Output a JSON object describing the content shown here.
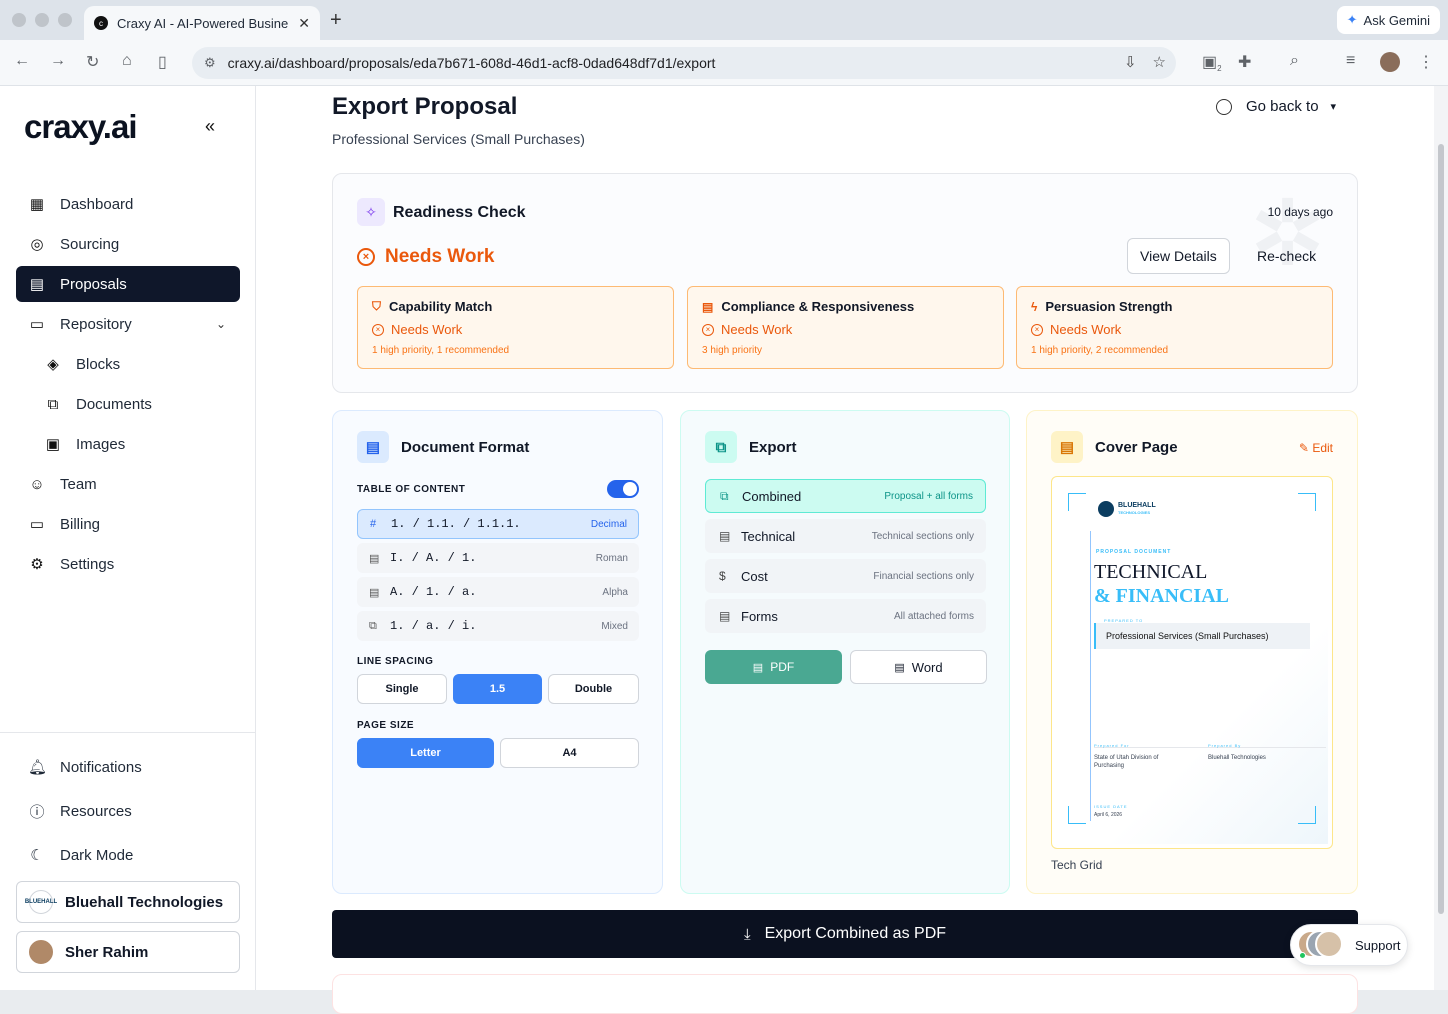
{
  "browser": {
    "tab_title": "Craxy AI - AI-Powered Busine",
    "url": "craxy.ai/dashboard/proposals/eda7b671-608d-46d1-acf8-0dad648df7d1/export",
    "ask_gemini": "Ask Gemini",
    "ext_badge": "2"
  },
  "sidebar": {
    "logo": "craxy.ai",
    "items": [
      {
        "label": "Dashboard",
        "icon": "dashboard-icon"
      },
      {
        "label": "Sourcing",
        "icon": "target-icon"
      },
      {
        "label": "Proposals",
        "icon": "proposal-icon"
      },
      {
        "label": "Repository",
        "icon": "book-icon"
      },
      {
        "label": "Blocks",
        "icon": "layers-icon"
      },
      {
        "label": "Documents",
        "icon": "documents-icon"
      },
      {
        "label": "Images",
        "icon": "image-icon"
      },
      {
        "label": "Team",
        "icon": "team-icon"
      },
      {
        "label": "Billing",
        "icon": "card-icon"
      },
      {
        "label": "Settings",
        "icon": "gear-icon"
      }
    ],
    "bottom": {
      "notifications": "Notifications",
      "resources": "Resources",
      "dark_mode": "Dark Mode",
      "org": "Bluehall Technologies",
      "org_logo_text": "BLUEHALL",
      "user": "Sher Rahim"
    }
  },
  "header": {
    "title": "Export Proposal",
    "subtitle": "Professional Services (Small Purchases)",
    "go_back": "Go back to"
  },
  "readiness": {
    "title": "Readiness Check",
    "time": "10 days ago",
    "status": "Needs Work",
    "view_details": "View Details",
    "recheck": "Re-check",
    "cards": [
      {
        "title": "Capability Match",
        "status": "Needs Work",
        "note": "1 high priority, 1 recommended"
      },
      {
        "title": "Compliance & Responsiveness",
        "status": "Needs Work",
        "note": "3 high priority"
      },
      {
        "title": "Persuasion Strength",
        "status": "Needs Work",
        "note": "1 high priority, 2 recommended"
      }
    ]
  },
  "doc_format": {
    "title": "Document Format",
    "toc_label": "TABLE OF CONTENT",
    "toc_enabled": true,
    "toc_options": [
      {
        "pattern": "1. / 1.1. / 1.1.1.",
        "name": "Decimal"
      },
      {
        "pattern": "I. / A. / 1.",
        "name": "Roman"
      },
      {
        "pattern": "A. / 1. / a.",
        "name": "Alpha"
      },
      {
        "pattern": "1. / a. / i.",
        "name": "Mixed"
      }
    ],
    "line_spacing_label": "LINE SPACING",
    "line_spacing": [
      "Single",
      "1.5",
      "Double"
    ],
    "line_spacing_selected": "1.5",
    "page_size_label": "PAGE SIZE",
    "page_size": [
      "Letter",
      "A4"
    ],
    "page_size_selected": "Letter"
  },
  "export": {
    "title": "Export",
    "options": [
      {
        "label": "Combined",
        "desc": "Proposal + all forms"
      },
      {
        "label": "Technical",
        "desc": "Technical sections only"
      },
      {
        "label": "Cost",
        "desc": "Financial sections only"
      },
      {
        "label": "Forms",
        "desc": "All attached forms"
      }
    ],
    "selected": "Combined",
    "pdf": "PDF",
    "word": "Word"
  },
  "cover": {
    "title": "Cover Page",
    "edit": "Edit",
    "logo": "BLUEHALL",
    "logo_sub": "TECHNOLOGIES",
    "kicker": "PROPOSAL DOCUMENT",
    "heading1": "TECHNICAL",
    "heading2": "& FINANCIAL",
    "prepared_label": "PREPARED TO",
    "project": "Professional Services (Small Purchases)",
    "prepared_for_label": "Prepared For",
    "prepared_for": "State of Utah Division of Purchasing",
    "prepared_by_label": "Prepared By",
    "prepared_by": "Bluehall Technologies",
    "issue_label": "ISSUE DATE",
    "date": "April 6, 2026",
    "template_name": "Tech Grid"
  },
  "export_button": "Export Combined as PDF",
  "support": "Support",
  "colors": {
    "accent_blue": "#3b82f6",
    "warning_orange": "#ea580c",
    "teal": "#4aa892",
    "dark": "#0b1120"
  }
}
